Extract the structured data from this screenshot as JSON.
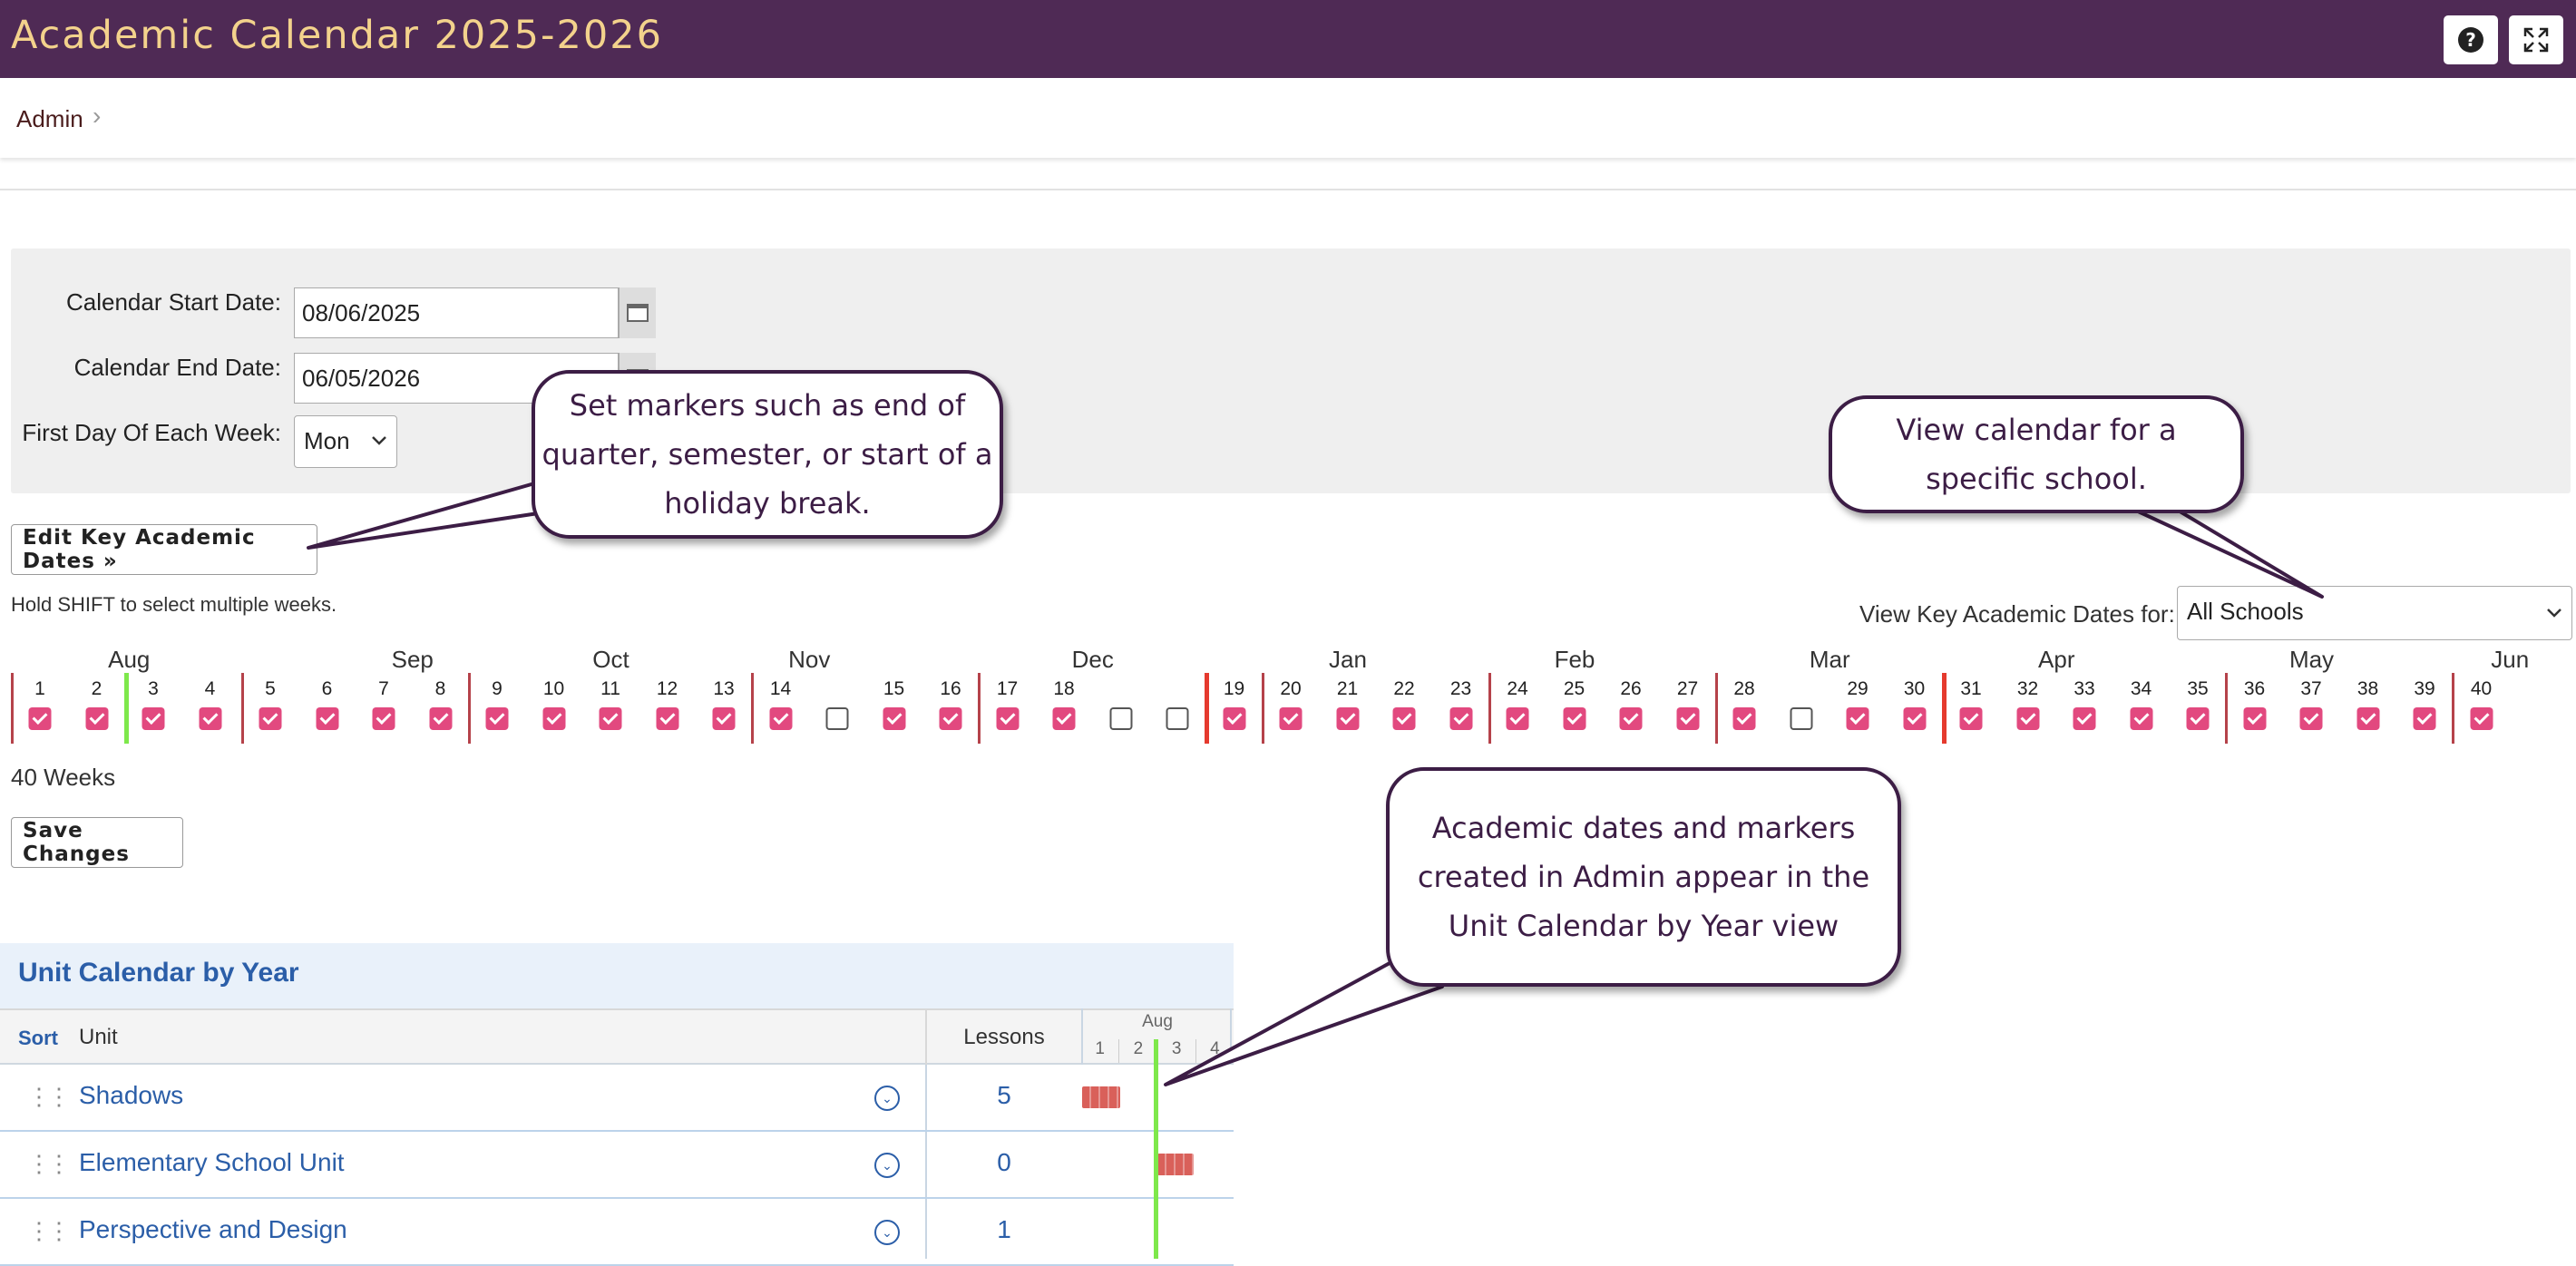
{
  "header": {
    "title": "Academic Calendar 2025-2026",
    "help_label": "?"
  },
  "breadcrumb": {
    "items": [
      {
        "label": "Admin"
      }
    ],
    "separator": "›"
  },
  "settings": {
    "start_label": "Calendar Start Date:",
    "start_value": "08/06/2025",
    "end_label": "Calendar End Date:",
    "end_value": "06/05/2026",
    "first_day_label": "First Day Of Each Week:",
    "first_day_value": "Mon"
  },
  "actions": {
    "edit_dates": "Edit Key Academic Dates »",
    "shift_hint": "Hold SHIFT to select multiple weeks.",
    "save": "Save Changes"
  },
  "school_filter": {
    "label": "View Key Academic Dates for:",
    "value": "All Schools"
  },
  "weeks": {
    "months": [
      "Aug",
      "Sep",
      "Oct",
      "Nov",
      "Dec",
      "Jan",
      "Feb",
      "Mar",
      "Apr",
      "May",
      "Jun"
    ],
    "numbers": [
      "1",
      "2",
      "3",
      "4",
      "5",
      "6",
      "7",
      "8",
      "9",
      "10",
      "11",
      "12",
      "13",
      "14",
      "",
      "15",
      "16",
      "17",
      "18",
      "",
      "",
      "19",
      "20",
      "21",
      "22",
      "23",
      "24",
      "25",
      "26",
      "27",
      "28",
      "",
      "29",
      "30",
      "31",
      "32",
      "33",
      "34",
      "35",
      "36",
      "37",
      "38",
      "39",
      "40"
    ],
    "checked": [
      1,
      1,
      1,
      1,
      1,
      1,
      1,
      1,
      1,
      1,
      1,
      1,
      1,
      1,
      0,
      1,
      1,
      1,
      1,
      0,
      0,
      1,
      1,
      1,
      1,
      1,
      1,
      1,
      1,
      1,
      1,
      0,
      1,
      1,
      1,
      1,
      1,
      1,
      1,
      1,
      1,
      1,
      1,
      1
    ],
    "summary": "40 Weeks",
    "marker_colors": {
      "month": "#b5424a",
      "key_date": "#e53a2e",
      "today": "#7ee84b"
    }
  },
  "callouts": {
    "markers": [
      "Set markers such as end of",
      "quarter, semester, or start of a",
      "holiday break."
    ],
    "school": [
      "View calendar for a",
      "specific school."
    ],
    "unit_view": [
      "Academic dates and markers",
      "created in Admin appear in the",
      "Unit Calendar by Year view"
    ]
  },
  "unit_calendar": {
    "title": "Unit Calendar by Year",
    "sort_label": "Sort",
    "unit_col": "Unit",
    "lessons_col": "Lessons",
    "timeline_month": "Aug",
    "timeline_weeks": [
      "1",
      "2",
      "3",
      "4"
    ],
    "rows": [
      {
        "name": "Shadows",
        "lessons": "5"
      },
      {
        "name": "Elementary School Unit",
        "lessons": "0"
      },
      {
        "name": "Perspective and Design",
        "lessons": "1"
      }
    ],
    "bar_color": "#d9605a"
  }
}
